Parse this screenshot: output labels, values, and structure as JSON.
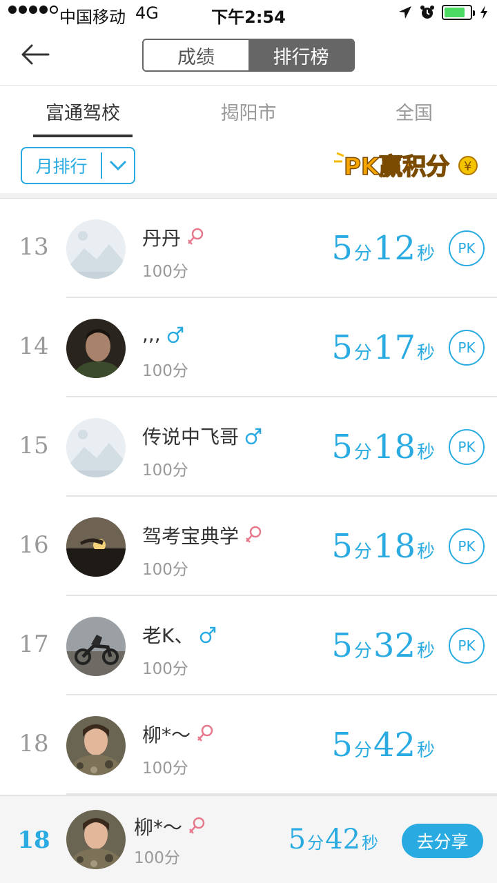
{
  "status_bar": {
    "carrier": "中国移动",
    "network": "4G",
    "time": "下午2:54"
  },
  "nav": {
    "segment_score": "成绩",
    "segment_ranking": "排行榜"
  },
  "tabs": [
    "富通驾校",
    "揭阳市",
    "全国"
  ],
  "filter": {
    "label": "月排行"
  },
  "banner": {
    "text": "PK赢积分"
  },
  "colors": {
    "accent": "#29abe2",
    "female": "#e8798c",
    "male": "#29abe2"
  },
  "rows": [
    {
      "rank": "13",
      "name": "丹丹",
      "gender": "female",
      "score": "100分",
      "min": "5",
      "min_unit": "分",
      "sec": "12",
      "sec_unit": "秒",
      "pk": "PK",
      "avatar": "placeholder"
    },
    {
      "rank": "14",
      "name": ",,,",
      "gender": "male",
      "score": "100分",
      "min": "5",
      "min_unit": "分",
      "sec": "17",
      "sec_unit": "秒",
      "pk": "PK",
      "avatar": "man-photo"
    },
    {
      "rank": "15",
      "name": "传说中飞哥",
      "gender": "male",
      "score": "100分",
      "min": "5",
      "min_unit": "分",
      "sec": "18",
      "sec_unit": "秒",
      "pk": "PK",
      "avatar": "placeholder"
    },
    {
      "rank": "16",
      "name": "驾考宝典学",
      "gender": "female",
      "score": "100分",
      "min": "5",
      "min_unit": "分",
      "sec": "18",
      "sec_unit": "秒",
      "pk": "PK",
      "avatar": "sunset-photo"
    },
    {
      "rank": "17",
      "name": "老K、",
      "gender": "male",
      "score": "100分",
      "min": "5",
      "min_unit": "分",
      "sec": "32",
      "sec_unit": "秒",
      "pk": "PK",
      "avatar": "motorbike-photo"
    },
    {
      "rank": "18",
      "name": "柳*～",
      "gender": "female",
      "score": "100分",
      "min": "5",
      "min_unit": "分",
      "sec": "42",
      "sec_unit": "秒",
      "pk": "",
      "avatar": "woman-photo"
    }
  ],
  "me": {
    "rank": "18",
    "name": "柳*～",
    "gender": "female",
    "score": "100分",
    "min": "5",
    "min_unit": "分",
    "sec": "42",
    "sec_unit": "秒",
    "share": "去分享",
    "avatar": "woman-photo"
  }
}
